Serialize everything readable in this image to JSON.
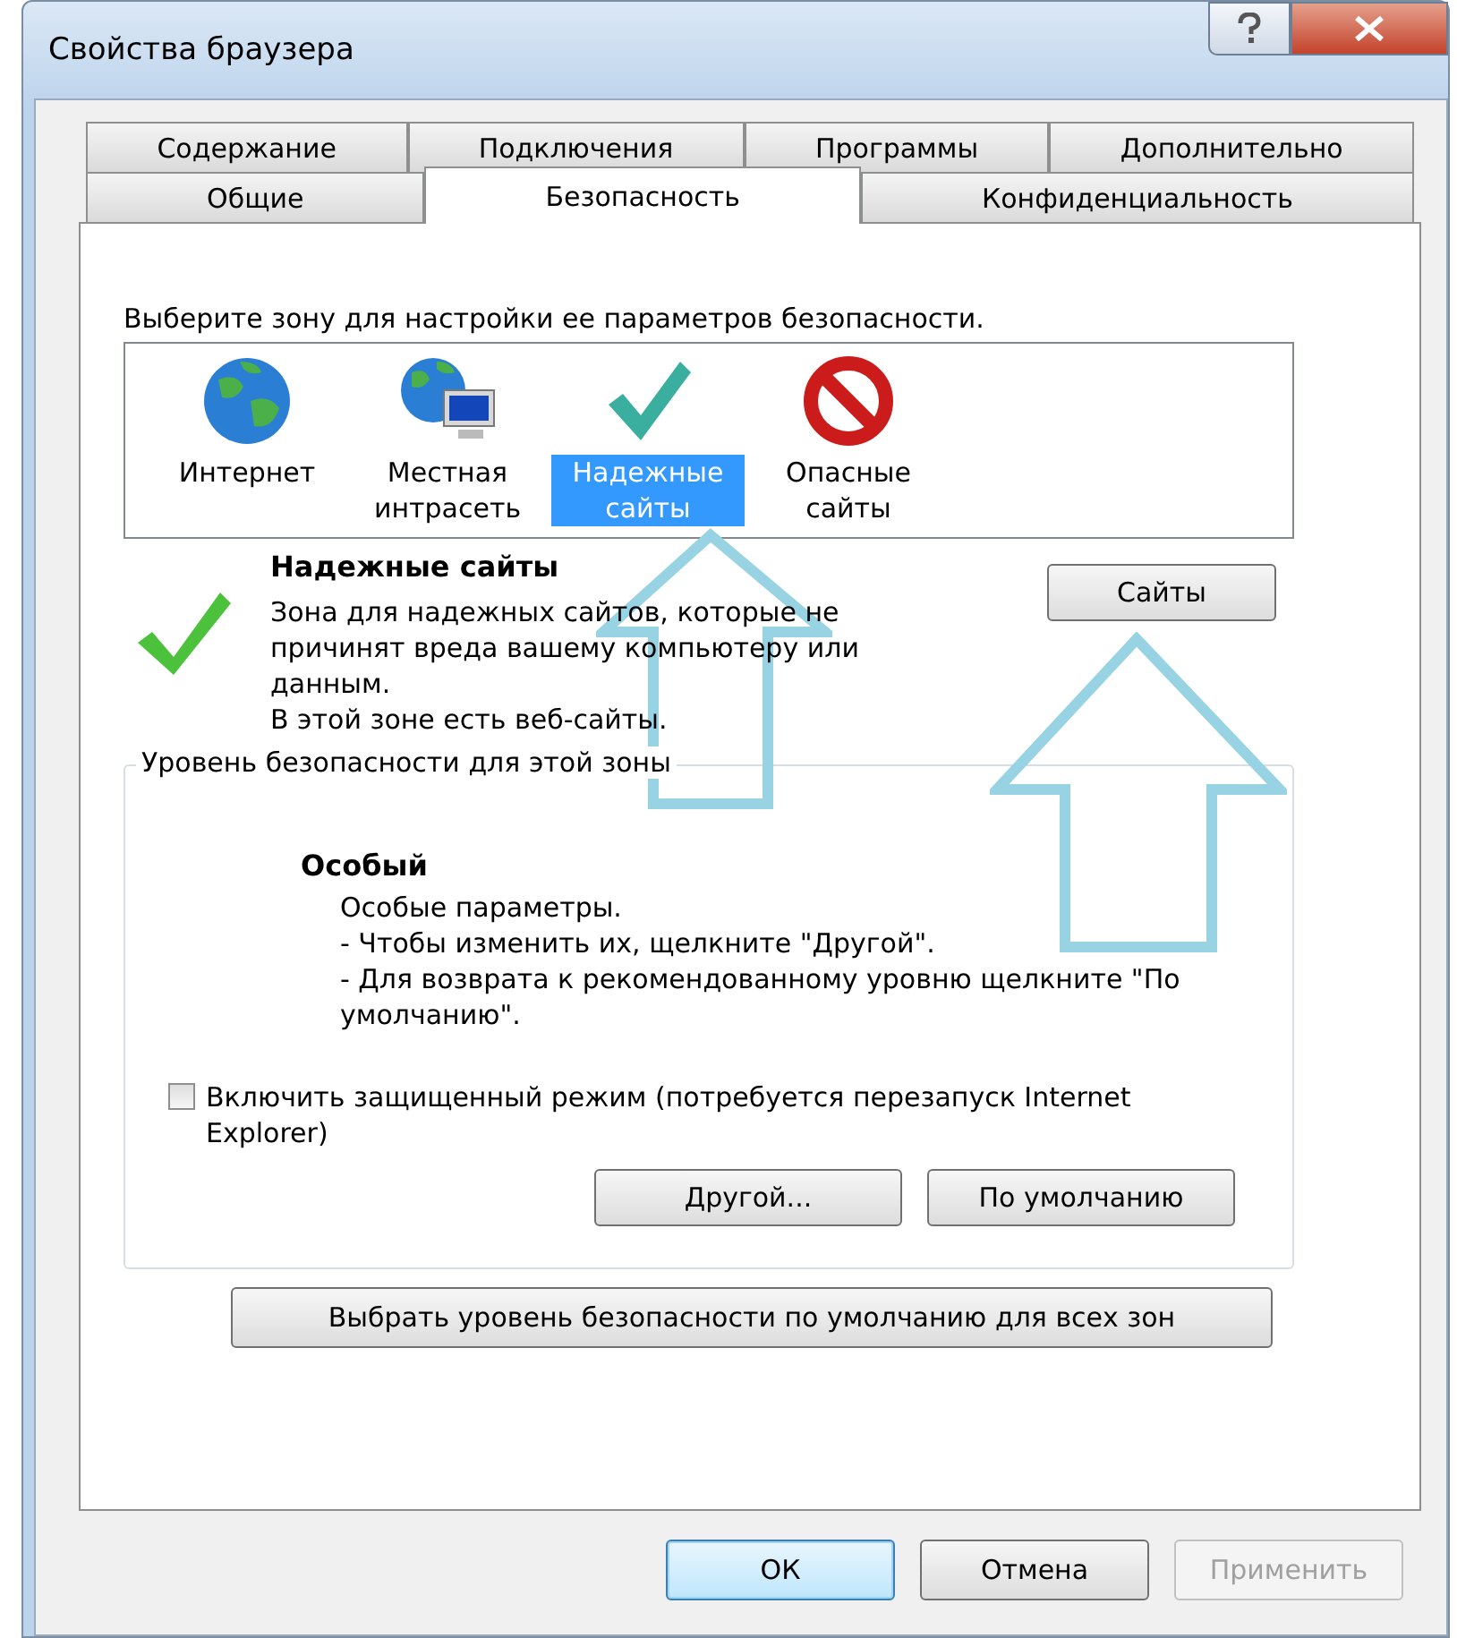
{
  "window": {
    "title": "Свойства браузера"
  },
  "tabs": [
    [
      {
        "label": "Содержание",
        "selected": false
      },
      {
        "label": "Подключения",
        "selected": false
      },
      {
        "label": "Программы",
        "selected": false
      },
      {
        "label": "Дополнительно",
        "selected": false
      }
    ],
    [
      {
        "label": "Общие",
        "selected": false
      },
      {
        "label": "Безопасность",
        "selected": true
      },
      {
        "label": "Конфиденциальность",
        "selected": false
      }
    ]
  ],
  "zones": {
    "prompt": "Выберите зону для настройки ее параметров безопасности.",
    "items": [
      {
        "kind": "internet",
        "label": "Интернет",
        "selected": false
      },
      {
        "kind": "intranet",
        "label": "Местная интрасеть",
        "selected": false
      },
      {
        "kind": "trusted",
        "label": "Надежные сайты",
        "selected": true
      },
      {
        "kind": "restricted",
        "label": "Опасные сайты",
        "selected": false
      }
    ]
  },
  "zone_detail": {
    "kind": "trusted",
    "title": "Надежные сайты",
    "description": "Зона для надежных сайтов, которые не причинят вреда вашему компьютеру или данным.",
    "note": "В этой зоне есть веб-сайты.",
    "sites_button": "Сайты"
  },
  "security_level": {
    "legend": "Уровень безопасности для этой зоны",
    "level_name": "Особый",
    "details": [
      "Особые параметры.",
      "- Чтобы изменить их, щелкните \"Другой\".",
      "- Для возврата к рекомендованному уровню щелкните \"По умолчанию\"."
    ],
    "protected_mode": {
      "label": "Включить защищенный режим (потребуется перезапуск Internet Explorer)",
      "checked": false
    },
    "buttons": [
      "Другой...",
      "По умолчанию"
    ]
  },
  "reset_all_button": "Выбрать уровень безопасности по умолчанию для всех зон",
  "footer_buttons": [
    {
      "label": "ОК",
      "default": true,
      "disabled": false
    },
    {
      "label": "Отмена",
      "default": false,
      "disabled": false
    },
    {
      "label": "Применить",
      "default": false,
      "disabled": true
    }
  ]
}
